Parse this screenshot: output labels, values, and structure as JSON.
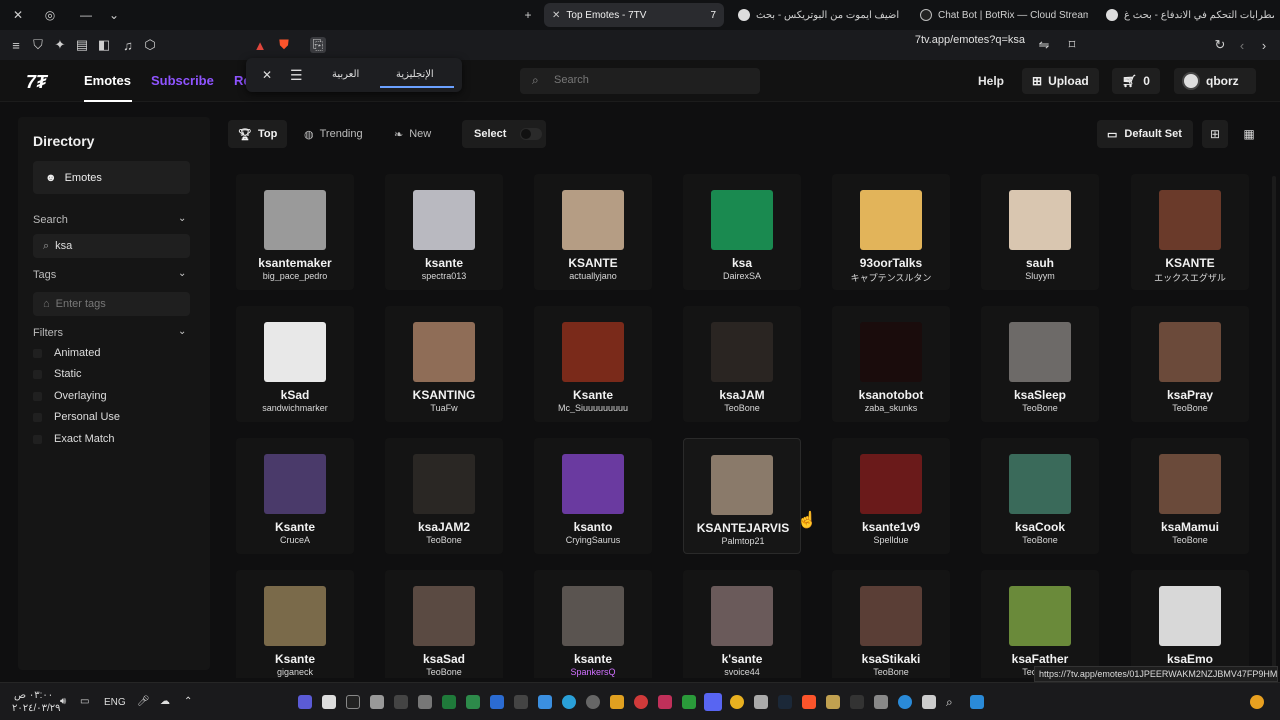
{
  "browser": {
    "tabs": [
      {
        "label": "Top Emotes - 7TV",
        "active": true
      },
      {
        "label": "كيف اضيف ايموت من البوتريكس - بحث",
        "active": false
      },
      {
        "label": "Chat Bot | BotRix — Cloud Streaming",
        "active": false
      },
      {
        "label": "اضطرابات التحكم في الاندفاع - بحث غ",
        "active": false
      }
    ],
    "url": "7tv.app/emotes?q=ksa",
    "status_url": "https://7tv.app/emotes/01JPEERWAKM2NZJBMV47FP9HM"
  },
  "translate_popup": {
    "langs": [
      "العربية",
      "الإنجليزية"
    ]
  },
  "header": {
    "nav": [
      "Emotes",
      "Subscribe",
      "Re"
    ],
    "search_placeholder": "Search",
    "help": "Help",
    "upload": "Upload",
    "cart_count": "0",
    "user": "qborz"
  },
  "sidebar": {
    "title": "Directory",
    "emotes_btn": "Emotes",
    "search_label": "Search",
    "search_value": "ksa",
    "tags_label": "Tags",
    "tags_placeholder": "Enter tags",
    "filters_label": "Filters",
    "filters": [
      "Animated",
      "Static",
      "Overlaying",
      "Personal Use",
      "Exact Match"
    ]
  },
  "toolbar": {
    "top": "Top",
    "trending": "Trending",
    "new": "New",
    "select": "Select",
    "default_set": "Default Set"
  },
  "emotes": [
    {
      "name": "ksantemaker",
      "author": "big_pace_pedro",
      "color": "#9a9a9a"
    },
    {
      "name": "ksante",
      "author": "spectra013",
      "color": "#b9b9c0"
    },
    {
      "name": "KSANTE",
      "author": "actuallyjano",
      "color": "#b59d84"
    },
    {
      "name": "ksa",
      "author": "DairexSA",
      "color": "#1a8a50"
    },
    {
      "name": "93oorTalks",
      "author": "キャプテンスルタン",
      "color": "#e2b45a"
    },
    {
      "name": "sauh",
      "author": "Sluyym",
      "color": "#d9c6b0"
    },
    {
      "name": "KSANTE",
      "author": "エックスエグザル",
      "color": "#6a3a2a"
    },
    {
      "name": "kSad",
      "author": "sandwichmarker",
      "color": "#e8e8e8"
    },
    {
      "name": "KSANTING",
      "author": "TuaFw",
      "color": "#8f6d57"
    },
    {
      "name": "Ksante",
      "author": "Mc_Siuuuuuuuuu",
      "color": "#7a2a1a"
    },
    {
      "name": "ksaJAM",
      "author": "TeoBone",
      "color": "#2a2522"
    },
    {
      "name": "ksanotobot",
      "author": "zaba_skunks",
      "color": "#1a0c0c"
    },
    {
      "name": "ksaSleep",
      "author": "TeoBone",
      "color": "#6d6a68"
    },
    {
      "name": "ksaPray",
      "author": "TeoBone",
      "color": "#6b4a3a"
    },
    {
      "name": "Ksante",
      "author": "CruceA",
      "color": "#4a3a6a"
    },
    {
      "name": "ksaJAM2",
      "author": "TeoBone",
      "color": "#2a2724"
    },
    {
      "name": "ksanto",
      "author": "CryingSaurus",
      "color": "#6a3aa0"
    },
    {
      "name": "KSANTEJARVIS",
      "author": "Palmtop21",
      "color": "#8a7a6a"
    },
    {
      "name": "ksante1v9",
      "author": "Spelldue",
      "color": "#6a1a1a"
    },
    {
      "name": "ksaCook",
      "author": "TeoBone",
      "color": "#3a6a5a"
    },
    {
      "name": "ksaMamui",
      "author": "TeoBone",
      "color": "#6a4a3a"
    },
    {
      "name": "Ksante",
      "author": "giganeck",
      "color": "#7a6a4a"
    },
    {
      "name": "ksaSad",
      "author": "TeoBone",
      "color": "#5a4a42"
    },
    {
      "name": "ksante",
      "author": "SpankersQ",
      "color": "#5a5450"
    },
    {
      "name": "k'sante",
      "author": "svoice44",
      "color": "#6a5a5a"
    },
    {
      "name": "ksaStikaki",
      "author": "TeoBone",
      "color": "#5a3e36"
    },
    {
      "name": "ksaFather",
      "author": "TeoBone",
      "color": "#6a8a3a"
    },
    {
      "name": "ksaEmo",
      "author": "TeoBone",
      "color": "#d8d8d8"
    }
  ],
  "taskbar": {
    "time": "٠٣:٠٠ ص",
    "date": "٢٠٢٤/٠٣/٢٩",
    "lang": "ENG"
  },
  "colors": {
    "accent_purple": "#8f54ff",
    "bg": "#0f0f10"
  }
}
